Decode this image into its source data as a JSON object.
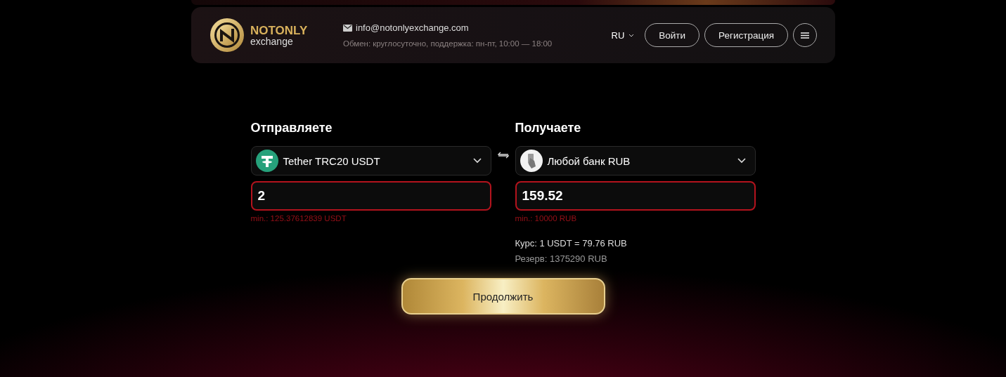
{
  "header": {
    "logo": {
      "name": "NOTONLY",
      "sub": "exchange"
    },
    "email": "info@notonlyexchange.com",
    "hours": "Обмен: круглосуточно, поддержка: пн-пт, 10:00 — 18:00",
    "language": "RU",
    "buttons": [
      "Войти",
      "Регистрация"
    ]
  },
  "send": {
    "label": "Отправляете",
    "currency": "Tether TRC20 USDT",
    "kind": "tether",
    "amount": "2",
    "invalid": true,
    "hint": "min.: 125.37612839 USDT"
  },
  "receive": {
    "label": "Получаете",
    "currency": "Любой банк RUB",
    "kind": "card",
    "amount": "159.52",
    "invalid": true,
    "hint": "min.: 10000 RUB",
    "rate": "Курс: 1 USDT = 79.76 RUB",
    "reserve": "Резерв: 1375290 RUB"
  },
  "submit": "Продолжить"
}
